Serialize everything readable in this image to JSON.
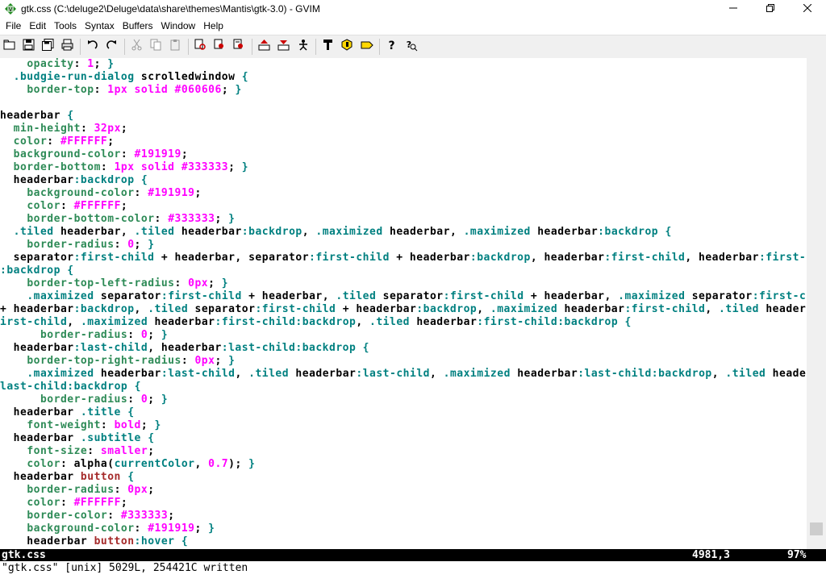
{
  "window": {
    "title": "gtk.css (C:\\deluge2\\Deluge\\data\\share\\themes\\Mantis\\gtk-3.0) - GVIM",
    "app_icon": "gvim-icon",
    "controls": [
      "minimize-icon",
      "maximize-icon",
      "close-icon"
    ]
  },
  "menu": {
    "items": [
      {
        "label": "File",
        "name": "menu-file"
      },
      {
        "label": "Edit",
        "name": "menu-edit"
      },
      {
        "label": "Tools",
        "name": "menu-tools"
      },
      {
        "label": "Syntax",
        "name": "menu-syntax"
      },
      {
        "label": "Buffers",
        "name": "menu-buffers"
      },
      {
        "label": "Window",
        "name": "menu-window"
      },
      {
        "label": "Help",
        "name": "menu-help"
      }
    ]
  },
  "toolbar": {
    "buttons": [
      "open-icon",
      "save-icon",
      "save-all-icon",
      "print-icon",
      "|",
      "undo-icon",
      "redo-icon",
      "|",
      "cut-icon",
      "copy-icon",
      "paste-icon",
      "|",
      "replace-icon",
      "find-next-icon",
      "find-prev-icon",
      "|",
      "load-session-icon",
      "save-session-icon",
      "run-script-icon",
      "|",
      "make-icon",
      "shell-icon",
      "tags-icon",
      "|",
      "help-icon",
      "find-help-icon"
    ]
  },
  "colors": {
    "plain": "#000000",
    "property": "#2e8b57",
    "value": "#ff00ff",
    "selector": "#008080",
    "keyword": "#a52a2a"
  },
  "editor": {
    "lines": [
      [
        [
          "    ",
          "p"
        ],
        [
          "opacity",
          "prop"
        ],
        [
          ": ",
          "p"
        ],
        [
          "1",
          "val"
        ],
        [
          "; ",
          "p"
        ],
        [
          "}",
          "sel"
        ]
      ],
      [
        [
          "  ",
          "p"
        ],
        [
          ".budgie-run-dialog",
          "sel"
        ],
        [
          " scrolledwindow ",
          "p"
        ],
        [
          "{",
          "sel"
        ]
      ],
      [
        [
          "    ",
          "p"
        ],
        [
          "border-top",
          "prop"
        ],
        [
          ": ",
          "p"
        ],
        [
          "1px solid #060606",
          "val"
        ],
        [
          "; ",
          "p"
        ],
        [
          "}",
          "sel"
        ]
      ],
      [
        [
          "",
          "p"
        ]
      ],
      [
        [
          "headerbar ",
          "p"
        ],
        [
          "{",
          "sel"
        ]
      ],
      [
        [
          "  ",
          "p"
        ],
        [
          "min-height",
          "prop"
        ],
        [
          ": ",
          "p"
        ],
        [
          "32px",
          "val"
        ],
        [
          ";",
          "p"
        ]
      ],
      [
        [
          "  ",
          "p"
        ],
        [
          "color",
          "prop"
        ],
        [
          ": ",
          "p"
        ],
        [
          "#FFFFFF",
          "val"
        ],
        [
          ";",
          "p"
        ]
      ],
      [
        [
          "  ",
          "p"
        ],
        [
          "background-color",
          "prop"
        ],
        [
          ": ",
          "p"
        ],
        [
          "#191919",
          "val"
        ],
        [
          ";",
          "p"
        ]
      ],
      [
        [
          "  ",
          "p"
        ],
        [
          "border-bottom",
          "prop"
        ],
        [
          ": ",
          "p"
        ],
        [
          "1px solid #333333",
          "val"
        ],
        [
          "; ",
          "p"
        ],
        [
          "}",
          "sel"
        ]
      ],
      [
        [
          "  headerbar",
          "p"
        ],
        [
          ":backdrop",
          "sel"
        ],
        [
          " ",
          "p"
        ],
        [
          "{",
          "sel"
        ]
      ],
      [
        [
          "    ",
          "p"
        ],
        [
          "background-color",
          "prop"
        ],
        [
          ": ",
          "p"
        ],
        [
          "#191919",
          "val"
        ],
        [
          ";",
          "p"
        ]
      ],
      [
        [
          "    ",
          "p"
        ],
        [
          "color",
          "prop"
        ],
        [
          ": ",
          "p"
        ],
        [
          "#FFFFFF",
          "val"
        ],
        [
          ";",
          "p"
        ]
      ],
      [
        [
          "    ",
          "p"
        ],
        [
          "border-bottom-color",
          "prop"
        ],
        [
          ": ",
          "p"
        ],
        [
          "#333333",
          "val"
        ],
        [
          "; ",
          "p"
        ],
        [
          "}",
          "sel"
        ]
      ],
      [
        [
          "  ",
          "p"
        ],
        [
          ".tiled",
          "sel"
        ],
        [
          " headerbar, ",
          "p"
        ],
        [
          ".tiled",
          "sel"
        ],
        [
          " headerbar",
          "p"
        ],
        [
          ":backdrop",
          "sel"
        ],
        [
          ", ",
          "p"
        ],
        [
          ".maximized",
          "sel"
        ],
        [
          " headerbar, ",
          "p"
        ],
        [
          ".maximized",
          "sel"
        ],
        [
          " headerbar",
          "p"
        ],
        [
          ":backdrop",
          "sel"
        ],
        [
          " ",
          "p"
        ],
        [
          "{",
          "sel"
        ]
      ],
      [
        [
          "    ",
          "p"
        ],
        [
          "border-radius",
          "prop"
        ],
        [
          ": ",
          "p"
        ],
        [
          "0",
          "val"
        ],
        [
          "; ",
          "p"
        ],
        [
          "}",
          "sel"
        ]
      ],
      [
        [
          "  separator",
          "p"
        ],
        [
          ":first-child",
          "sel"
        ],
        [
          " + headerbar, separator",
          "p"
        ],
        [
          ":first-child",
          "sel"
        ],
        [
          " + headerbar",
          "p"
        ],
        [
          ":backdrop",
          "sel"
        ],
        [
          ", headerbar",
          "p"
        ],
        [
          ":first-child",
          "sel"
        ],
        [
          ", headerbar",
          "p"
        ],
        [
          ":first-child",
          "sel"
        ]
      ],
      [
        [
          ":backdrop",
          "sel"
        ],
        [
          " ",
          "p"
        ],
        [
          "{",
          "sel"
        ]
      ],
      [
        [
          "    ",
          "p"
        ],
        [
          "border-top-left-radius",
          "prop"
        ],
        [
          ": ",
          "p"
        ],
        [
          "0px",
          "val"
        ],
        [
          "; ",
          "p"
        ],
        [
          "}",
          "sel"
        ]
      ],
      [
        [
          "    ",
          "p"
        ],
        [
          ".maximized",
          "sel"
        ],
        [
          " separator",
          "p"
        ],
        [
          ":first-child",
          "sel"
        ],
        [
          " + headerbar, ",
          "p"
        ],
        [
          ".tiled",
          "sel"
        ],
        [
          " separator",
          "p"
        ],
        [
          ":first-child",
          "sel"
        ],
        [
          " + headerbar, ",
          "p"
        ],
        [
          ".maximized",
          "sel"
        ],
        [
          " separator",
          "p"
        ],
        [
          ":first-child",
          "sel"
        ]
      ],
      [
        [
          "+ headerbar",
          "p"
        ],
        [
          ":backdrop",
          "sel"
        ],
        [
          ", ",
          "p"
        ],
        [
          ".tiled",
          "sel"
        ],
        [
          " separator",
          "p"
        ],
        [
          ":first-child",
          "sel"
        ],
        [
          " + headerbar",
          "p"
        ],
        [
          ":backdrop",
          "sel"
        ],
        [
          ", ",
          "p"
        ],
        [
          ".maximized",
          "sel"
        ],
        [
          " headerbar",
          "p"
        ],
        [
          ":first-child",
          "sel"
        ],
        [
          ", ",
          "p"
        ],
        [
          ".tiled",
          "sel"
        ],
        [
          " headerbar",
          "p"
        ],
        [
          ":f",
          "sel"
        ]
      ],
      [
        [
          "irst-child",
          "sel"
        ],
        [
          ", ",
          "p"
        ],
        [
          ".maximized",
          "sel"
        ],
        [
          " headerbar",
          "p"
        ],
        [
          ":first-child",
          "sel"
        ],
        [
          ":backdrop",
          "sel"
        ],
        [
          ", ",
          "p"
        ],
        [
          ".tiled",
          "sel"
        ],
        [
          " headerbar",
          "p"
        ],
        [
          ":first-child",
          "sel"
        ],
        [
          ":backdrop",
          "sel"
        ],
        [
          " ",
          "p"
        ],
        [
          "{",
          "sel"
        ]
      ],
      [
        [
          "      ",
          "p"
        ],
        [
          "border-radius",
          "prop"
        ],
        [
          ": ",
          "p"
        ],
        [
          "0",
          "val"
        ],
        [
          "; ",
          "p"
        ],
        [
          "}",
          "sel"
        ]
      ],
      [
        [
          "  headerbar",
          "p"
        ],
        [
          ":last-child",
          "sel"
        ],
        [
          ", headerbar",
          "p"
        ],
        [
          ":last-child",
          "sel"
        ],
        [
          ":backdrop",
          "sel"
        ],
        [
          " ",
          "p"
        ],
        [
          "{",
          "sel"
        ]
      ],
      [
        [
          "    ",
          "p"
        ],
        [
          "border-top-right-radius",
          "prop"
        ],
        [
          ": ",
          "p"
        ],
        [
          "0px",
          "val"
        ],
        [
          "; ",
          "p"
        ],
        [
          "}",
          "sel"
        ]
      ],
      [
        [
          "    ",
          "p"
        ],
        [
          ".maximized",
          "sel"
        ],
        [
          " headerbar",
          "p"
        ],
        [
          ":last-child",
          "sel"
        ],
        [
          ", ",
          "p"
        ],
        [
          ".tiled",
          "sel"
        ],
        [
          " headerbar",
          "p"
        ],
        [
          ":last-child",
          "sel"
        ],
        [
          ", ",
          "p"
        ],
        [
          ".maximized",
          "sel"
        ],
        [
          " headerbar",
          "p"
        ],
        [
          ":last-child",
          "sel"
        ],
        [
          ":backdrop",
          "sel"
        ],
        [
          ", ",
          "p"
        ],
        [
          ".tiled",
          "sel"
        ],
        [
          " headerbar",
          "p"
        ],
        [
          ":",
          "sel"
        ]
      ],
      [
        [
          "last-child",
          "sel"
        ],
        [
          ":backdrop",
          "sel"
        ],
        [
          " ",
          "p"
        ],
        [
          "{",
          "sel"
        ]
      ],
      [
        [
          "      ",
          "p"
        ],
        [
          "border-radius",
          "prop"
        ],
        [
          ": ",
          "p"
        ],
        [
          "0",
          "val"
        ],
        [
          "; ",
          "p"
        ],
        [
          "}",
          "sel"
        ]
      ],
      [
        [
          "  headerbar ",
          "p"
        ],
        [
          ".title",
          "sel"
        ],
        [
          " ",
          "p"
        ],
        [
          "{",
          "sel"
        ]
      ],
      [
        [
          "    ",
          "p"
        ],
        [
          "font-weight",
          "prop"
        ],
        [
          ": ",
          "p"
        ],
        [
          "bold",
          "val"
        ],
        [
          "; ",
          "p"
        ],
        [
          "}",
          "sel"
        ]
      ],
      [
        [
          "  headerbar ",
          "p"
        ],
        [
          ".subtitle",
          "sel"
        ],
        [
          " ",
          "p"
        ],
        [
          "{",
          "sel"
        ]
      ],
      [
        [
          "    ",
          "p"
        ],
        [
          "font-size",
          "prop"
        ],
        [
          ": ",
          "p"
        ],
        [
          "smaller",
          "val"
        ],
        [
          ";",
          "p"
        ]
      ],
      [
        [
          "    ",
          "p"
        ],
        [
          "color",
          "prop"
        ],
        [
          ": alpha(",
          "p"
        ],
        [
          "currentColor",
          "sel"
        ],
        [
          ", ",
          "p"
        ],
        [
          "0.7",
          "val"
        ],
        [
          "); ",
          "p"
        ],
        [
          "}",
          "sel"
        ]
      ],
      [
        [
          "  headerbar ",
          "p"
        ],
        [
          "button",
          "kw"
        ],
        [
          " ",
          "p"
        ],
        [
          "{",
          "sel"
        ]
      ],
      [
        [
          "    ",
          "p"
        ],
        [
          "border-radius",
          "prop"
        ],
        [
          ": ",
          "p"
        ],
        [
          "0px",
          "val"
        ],
        [
          ";",
          "p"
        ]
      ],
      [
        [
          "    ",
          "p"
        ],
        [
          "color",
          "prop"
        ],
        [
          ": ",
          "p"
        ],
        [
          "#FFFFFF",
          "val"
        ],
        [
          ";",
          "p"
        ]
      ],
      [
        [
          "    ",
          "p"
        ],
        [
          "border-color",
          "prop"
        ],
        [
          ": ",
          "p"
        ],
        [
          "#333333",
          "val"
        ],
        [
          ";",
          "p"
        ]
      ],
      [
        [
          "    ",
          "p"
        ],
        [
          "background-color",
          "prop"
        ],
        [
          ": ",
          "p"
        ],
        [
          "#191919",
          "val"
        ],
        [
          "; ",
          "p"
        ],
        [
          "}",
          "sel"
        ]
      ],
      [
        [
          "    headerbar ",
          "p"
        ],
        [
          "button",
          "kw"
        ],
        [
          ":hover",
          "sel"
        ],
        [
          " ",
          "p"
        ],
        [
          "{",
          "sel"
        ]
      ]
    ]
  },
  "statusline": {
    "file": "gtk.css",
    "position": "4981,3",
    "percent": "97%"
  },
  "cmdline": {
    "message": "\"gtk.css\" [unix] 5029L, 254421C written"
  }
}
